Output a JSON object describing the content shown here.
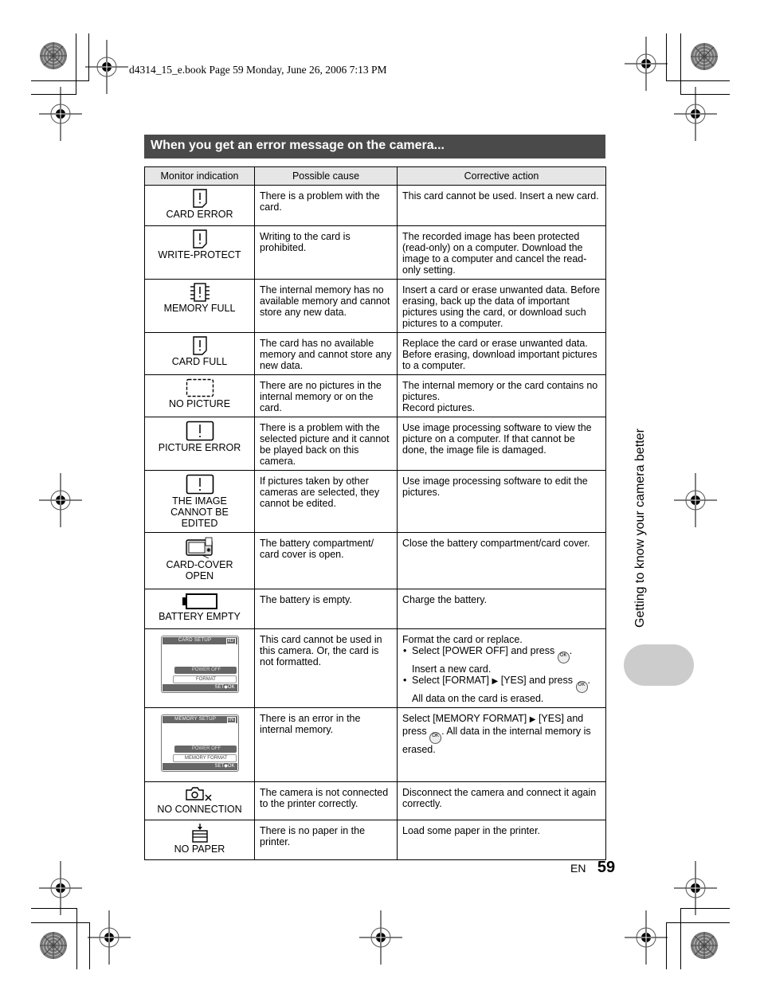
{
  "print_header": "d4314_15_e.book  Page 59  Monday, June 26, 2006  7:13 PM",
  "section_title": "When you get an error message on the camera...",
  "table": {
    "columns": [
      "Monitor indication",
      "Possible cause",
      "Corrective action"
    ],
    "rows": [
      {
        "icon": "card-error-icon",
        "label": "CARD ERROR",
        "cause": "There is a problem with the card.",
        "action": "This card cannot be used. Insert a new card."
      },
      {
        "icon": "write-protect-icon",
        "label": "WRITE-PROTECT",
        "cause": "Writing to the card is prohibited.",
        "action": "The recorded image has been protected (read-only) on a computer. Download the image to a computer and cancel the read-only setting."
      },
      {
        "icon": "memory-full-icon",
        "label": "MEMORY FULL",
        "cause": "The internal memory has no available memory and cannot store any new data.",
        "action": "Insert a card or erase unwanted data. Before erasing, back up the data of important pictures using the card, or download such pictures to a computer."
      },
      {
        "icon": "card-full-icon",
        "label": "CARD FULL",
        "cause": "The card has no available memory and cannot store any new data.",
        "action": "Replace the card or erase unwanted data. Before erasing, download important pictures to a computer."
      },
      {
        "icon": "no-picture-icon",
        "label": "NO PICTURE",
        "cause": "There are no pictures in the internal memory or on the card.",
        "action_lines": [
          "The internal memory or the card contains no pictures.",
          "Record pictures."
        ]
      },
      {
        "icon": "picture-error-icon",
        "label": "PICTURE ERROR",
        "cause": "There is a problem with the selected picture and it cannot be played back on this camera.",
        "action": "Use image processing software to view the picture on a computer. If that cannot be done, the image file is damaged."
      },
      {
        "icon": "image-cannot-be-edited-icon",
        "label": "THE IMAGE CANNOT BE EDITED",
        "cause": "If pictures taken by other cameras are selected, they cannot be edited.",
        "action": "Use image processing software to edit the pictures."
      },
      {
        "icon": "card-cover-open-icon",
        "label_lines": [
          "CARD-COVER",
          "OPEN"
        ],
        "cause": "The battery compartment/ card cover is open.",
        "action": "Close the battery compartment/card cover."
      },
      {
        "icon": "battery-empty-icon",
        "label": "BATTERY EMPTY",
        "cause": "The battery is empty.",
        "action": "Charge the battery."
      },
      {
        "screen": {
          "title": "CARD SETUP",
          "tag": "xD",
          "option1": "POWER OFF",
          "option2": "FORMAT",
          "footer": "SET◆OK"
        },
        "cause": "This card cannot be used in this camera. Or, the card is not formatted.",
        "action_intro": "Format the card or replace.",
        "steps": [
          {
            "pre": "Select [POWER OFF] and press",
            "button": "OK",
            "post": ".",
            "extra": "Insert a new card."
          },
          {
            "pre": "Select [FORMAT]",
            "arrow": "▶",
            "mid": "[YES] and press",
            "button": "OK",
            "post": ".",
            "extra": "All data on the card is erased."
          }
        ]
      },
      {
        "screen": {
          "title": "MEMORY SETUP",
          "tag": "IN",
          "option1": "POWER OFF",
          "option2": "MEMORY FORMAT",
          "footer": "SET◆OK"
        },
        "cause": "There is an error in the internal memory.",
        "action_pre": "Select [MEMORY FORMAT]",
        "action_arrow": "▶",
        "action_mid": "[YES] and press",
        "action_button": "OK",
        "action_post": ". All data in the internal memory is erased."
      },
      {
        "icon": "no-connection-icon",
        "label": "NO CONNECTION",
        "cause": "The camera is not connected to the printer correctly.",
        "action": "Disconnect the camera and connect it again correctly."
      },
      {
        "icon": "no-paper-icon",
        "label": "NO PAPER",
        "cause": "There is no paper in the printer.",
        "action": "Load some paper in the printer."
      }
    ]
  },
  "side_label": "Getting to know your camera better",
  "footer": {
    "lang": "EN",
    "page": "59"
  },
  "colors": {
    "section_bar": "#4a4a4a",
    "header_row": "#e6e6e6",
    "side_tab": "#cccccc"
  }
}
